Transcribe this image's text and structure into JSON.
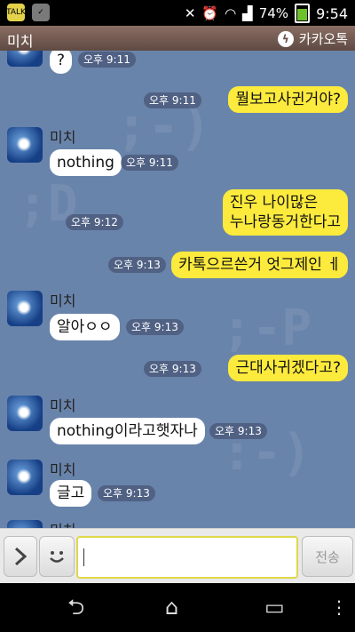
{
  "status_bar": {
    "battery_percent": "74%",
    "time": "9:54",
    "icons": [
      "kakaotalk-notification-icon",
      "bag-icon",
      "mute-icon",
      "alarm-icon",
      "wifi-icon",
      "signal-icon",
      "battery-icon"
    ]
  },
  "header": {
    "title": "미치",
    "brand": "카카오톡"
  },
  "chat": {
    "messages": [
      {
        "dir": "in",
        "sender": "",
        "text": "?",
        "time": "오후 9:11"
      },
      {
        "dir": "out",
        "text": "뭘보고사귄거야?",
        "time": "오후 9:11"
      },
      {
        "dir": "in",
        "sender": "미치",
        "text": "nothing",
        "time": "오후 9:11"
      },
      {
        "dir": "out",
        "text": "진우 나이많은\n누나랑동거한다고",
        "time": "오후 9:12"
      },
      {
        "dir": "out",
        "text": "카톡으르쓴거 엇그제인 ㅔ",
        "time": "오후 9:13"
      },
      {
        "dir": "in",
        "sender": "미치",
        "text": "알아ㅇㅇ",
        "time": "오후 9:13"
      },
      {
        "dir": "out",
        "text": "근대사귀겠다고?",
        "time": "오후 9:13"
      },
      {
        "dir": "in",
        "sender": "미치",
        "text": "nothing이라고햇자나",
        "time": "오후 9:13"
      },
      {
        "dir": "in",
        "sender": "미치",
        "text": "글고",
        "time": "오후 9:13"
      },
      {
        "dir": "in",
        "sender": "미치",
        "text": "",
        "time": ""
      }
    ]
  },
  "input": {
    "value": "",
    "send_label": "전송"
  },
  "colors": {
    "chat_bg": "#6984ab",
    "outgoing_bubble": "#fcea3d",
    "incoming_bubble": "#ffffff"
  }
}
